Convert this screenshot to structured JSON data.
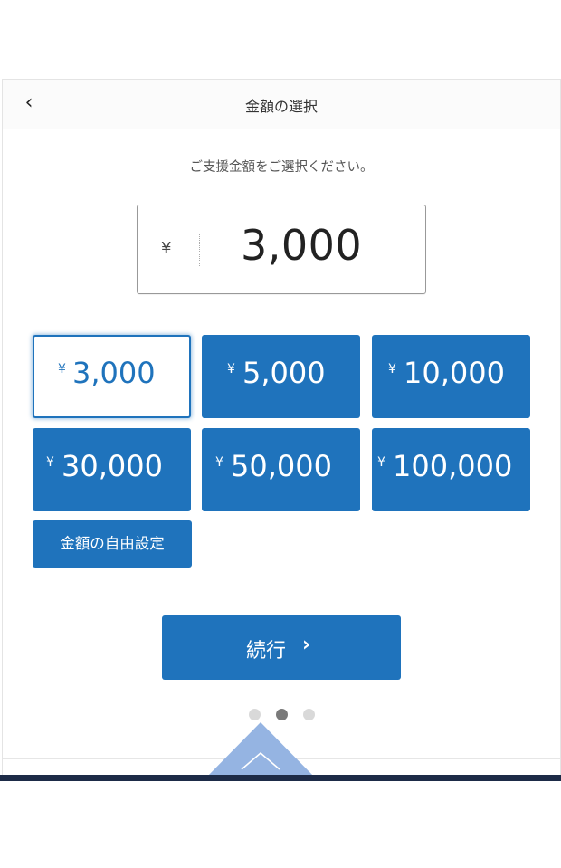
{
  "header": {
    "back_icon": "chevron-left-icon",
    "back_glyph": "‹",
    "title": "金額の選択"
  },
  "subtitle": "ご支援金額をご選択ください。",
  "amount_display": {
    "currency_symbol": "¥",
    "value": "3,000"
  },
  "amount_options": [
    {
      "symbol": "¥",
      "amount": "3,000",
      "selected": true
    },
    {
      "symbol": "¥",
      "amount": "5,000",
      "selected": false
    },
    {
      "symbol": "¥",
      "amount": "10,000",
      "selected": false
    },
    {
      "symbol": "¥",
      "amount": "30,000",
      "selected": false
    },
    {
      "symbol": "¥",
      "amount": "50,000",
      "selected": false
    },
    {
      "symbol": "¥",
      "amount": "100,000",
      "selected": false
    }
  ],
  "free_setting_label": "金額の自由設定",
  "continue": {
    "label": "続行",
    "chevron": "›",
    "icon": "chevron-right-icon"
  },
  "pagination": {
    "total": 3,
    "current": 2
  },
  "colors": {
    "primary": "#1f73bc",
    "triangle": "#95b4e2",
    "footer_bar": "#1d2b47",
    "dot_inactive": "#d9d9d9",
    "dot_active": "#7a7a7a"
  },
  "scroll_up_icon": "chevron-up-icon"
}
